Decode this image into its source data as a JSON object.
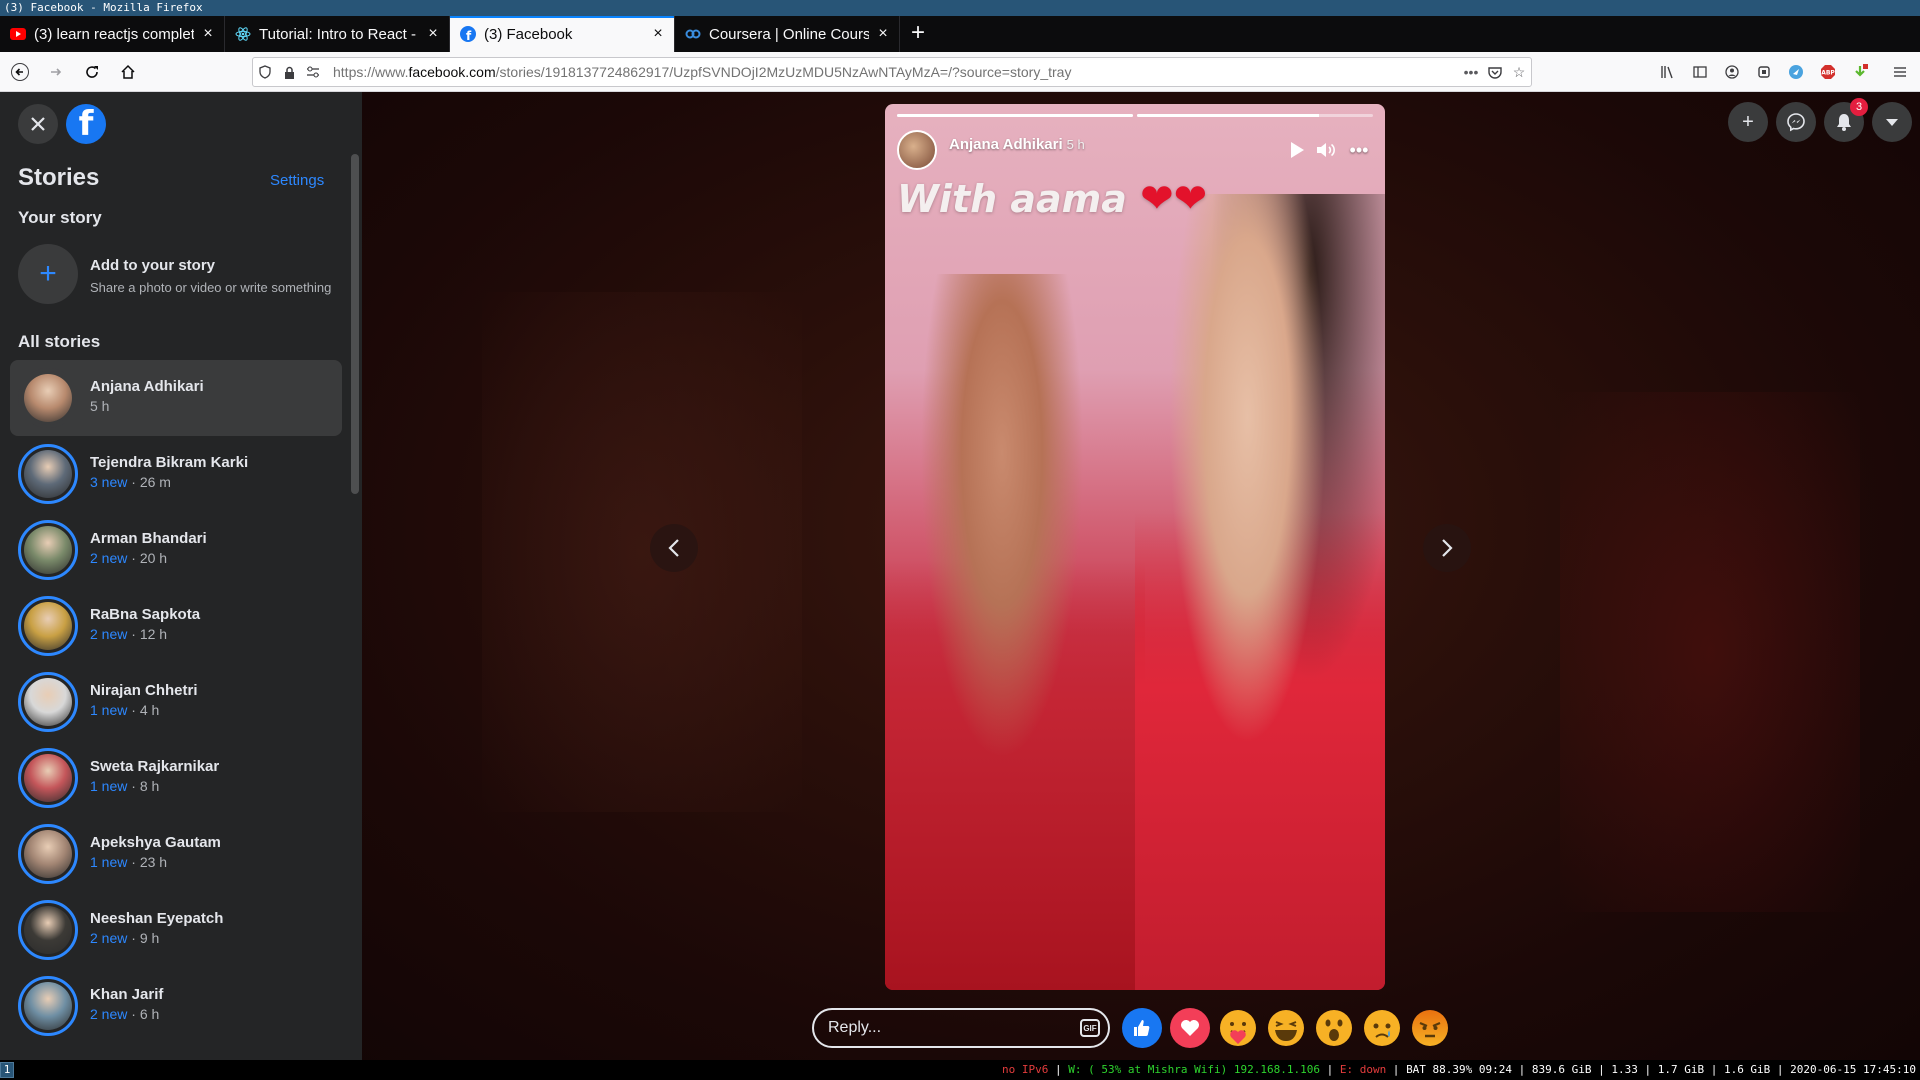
{
  "window": {
    "title": "(3) Facebook - Mozilla Firefox"
  },
  "tabs": [
    {
      "label": "(3) learn reactjs complet",
      "favicon": "youtube-icon",
      "color": "#ff0000"
    },
    {
      "label": "Tutorial: Intro to React -",
      "favicon": "react-icon",
      "color": "#61dafb"
    },
    {
      "label": "(3) Facebook",
      "favicon": "facebook-icon",
      "color": "#1877f2"
    },
    {
      "label": "Coursera | Online Course",
      "favicon": "coursera-icon",
      "color": "#0056d2"
    }
  ],
  "urlbar": {
    "prefix": "https://www.",
    "domain": "facebook.com",
    "path": "/stories/1918137724862917/UzpfSVNDOjI2MzUzMDU5NzAwNTAyMzA=/?source=story_tray"
  },
  "sidebar": {
    "title": "Stories",
    "settings_label": "Settings",
    "your_story_label": "Your story",
    "add_story_title": "Add to your story",
    "add_story_subtitle": "Share a photo or video or write something",
    "all_stories_label": "All stories",
    "stories": [
      {
        "name": "Anjana Adhikari",
        "new": "",
        "time": "5 h",
        "selected": true,
        "avatar": "#b88a6e"
      },
      {
        "name": "Tejendra Bikram Karki",
        "new": "3 new",
        "time": "26 m",
        "avatar": "#5e6a78"
      },
      {
        "name": "Arman Bhandari",
        "new": "2 new",
        "time": "20 h",
        "avatar": "#7a8a6a"
      },
      {
        "name": "RaBna Sapkota",
        "new": "2 new",
        "time": "12 h",
        "avatar": "#c9a044"
      },
      {
        "name": "Nirajan Chhetri",
        "new": "1 new",
        "time": "4 h",
        "avatar": "#d8d8d8"
      },
      {
        "name": "Sweta Rajkarnikar",
        "new": "1 new",
        "time": "8 h",
        "avatar": "#c4565a"
      },
      {
        "name": "Apekshya Gautam",
        "new": "1 new",
        "time": "23 h",
        "avatar": "#a38674"
      },
      {
        "name": "Neeshan Eyepatch",
        "new": "2 new",
        "time": "9 h",
        "avatar": "#3c3a36"
      },
      {
        "name": "Khan Jarif",
        "new": "2 new",
        "time": "6 h",
        "avatar": "#6f8fa4"
      }
    ]
  },
  "viewer": {
    "notification_count": "3",
    "story": {
      "author": "Anjana Adhikari",
      "time": "5 h",
      "caption": "With aama",
      "caption_emoji": "❤❤",
      "progress": [
        1.0,
        0.77
      ]
    },
    "reply_placeholder": "Reply...",
    "gif_label": "GIF"
  },
  "statusbar": {
    "workspace": "1",
    "ipv6": "no IPv6",
    "wifi": "W: ( 53% at Mishra Wifi) 192.168.1.106",
    "eth": "E: down",
    "rest": "BAT 88.39% 09:24 | 839.6 GiB | 1.33 | 1.7 GiB | 1.6 GiB | 2020-06-15 17:45:10"
  }
}
